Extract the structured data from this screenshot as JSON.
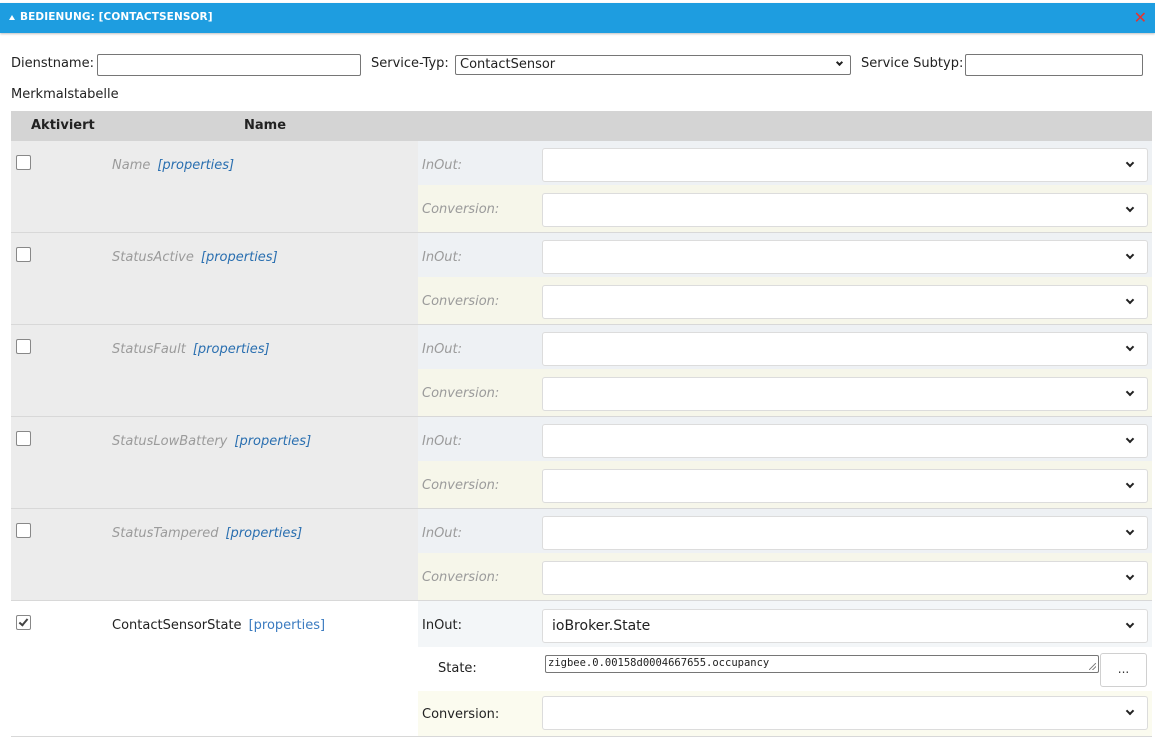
{
  "window": {
    "title": "BEDIENUNG: [CONTACTSENSOR]",
    "close_icon": "close-icon"
  },
  "form": {
    "dienstname_label": "Dienstname:",
    "dienstname_value": "",
    "service_typ_label": "Service-Typ:",
    "service_typ_value": "ContactSensor",
    "service_subtyp_label": "Service Subtyp:",
    "service_subtyp_value": ""
  },
  "table": {
    "caption": "Merkmalstabelle",
    "headers": {
      "aktiviert": "Aktiviert",
      "name": "Name"
    },
    "inout_label": "InOut:",
    "conversion_label": "Conversion:",
    "state_label": "State:",
    "properties_link": "[properties]",
    "rows": [
      {
        "name": "Name",
        "checked": false,
        "inout": "",
        "conversion": ""
      },
      {
        "name": "StatusActive",
        "checked": false,
        "inout": "",
        "conversion": ""
      },
      {
        "name": "StatusFault",
        "checked": false,
        "inout": "",
        "conversion": ""
      },
      {
        "name": "StatusLowBattery",
        "checked": false,
        "inout": "",
        "conversion": ""
      },
      {
        "name": "StatusTampered",
        "checked": false,
        "inout": "",
        "conversion": ""
      },
      {
        "name": "ContactSensorState",
        "checked": true,
        "inout": "ioBroker.State",
        "conversion": "",
        "state": "zigbee.0.00158d0004667655.occupancy",
        "browse_label": "..."
      }
    ]
  },
  "colors": {
    "titlebar": "#1e9de0",
    "close": "#e8322e",
    "link": "#2a6fb0"
  }
}
